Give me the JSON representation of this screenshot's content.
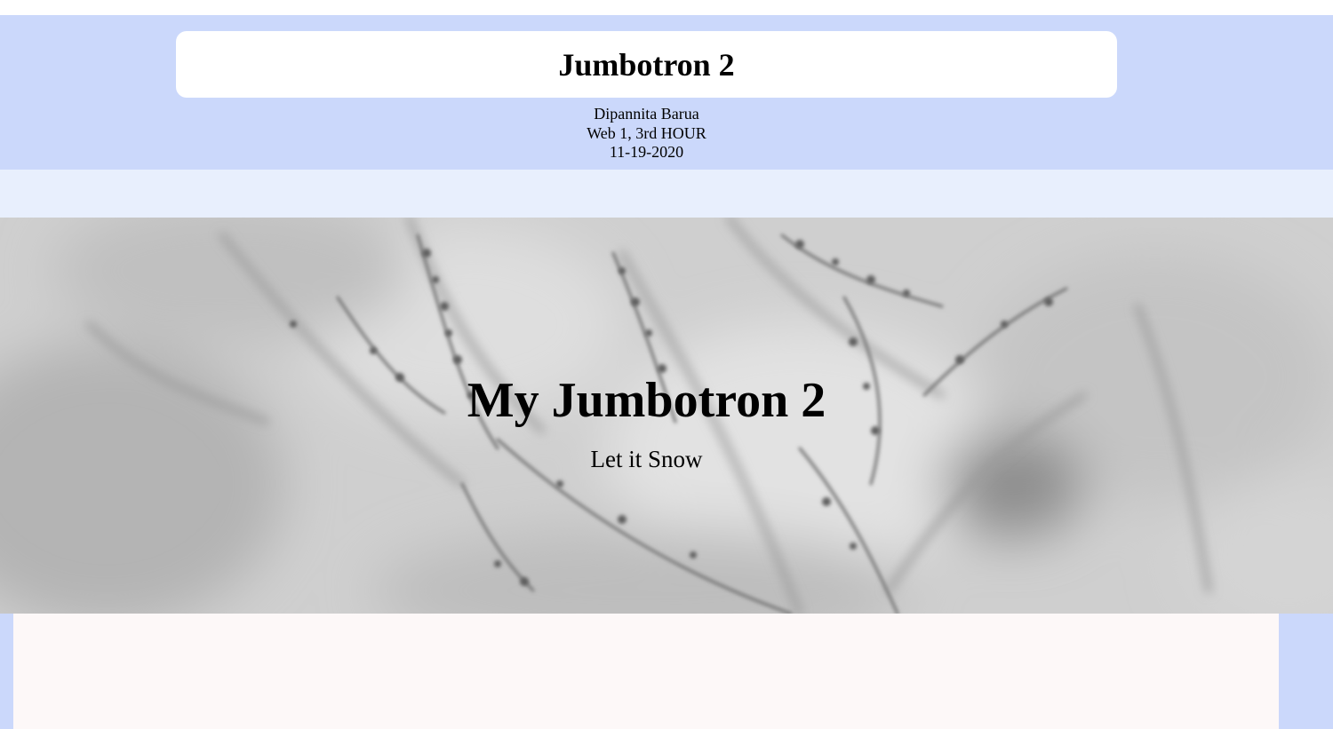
{
  "header": {
    "title": "Jumbotron 2",
    "author": "Dipannita Barua",
    "class_info": "Web 1, 3rd HOUR",
    "date": "11-19-2020"
  },
  "hero": {
    "heading": "My Jumbotron 2",
    "tagline": "Let it Snow"
  },
  "colors": {
    "header_bg": "#cbd8fb",
    "nav_bg": "#e8effd",
    "content_bg": "#fdf8f8"
  }
}
